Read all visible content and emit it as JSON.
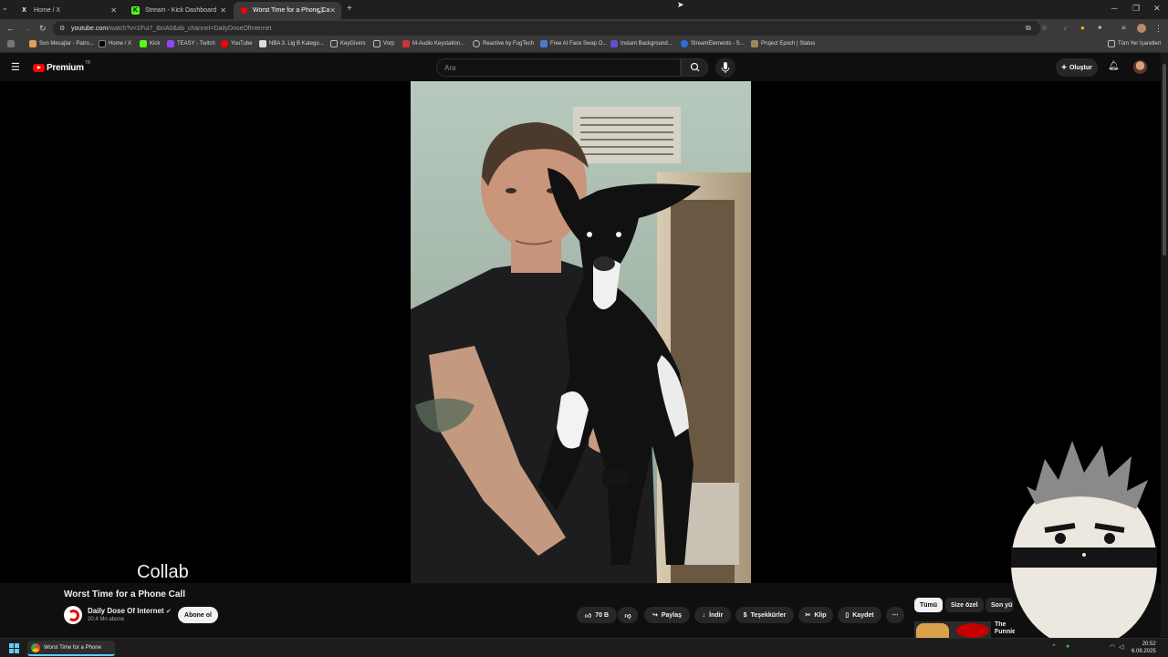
{
  "browser": {
    "tabs": [
      {
        "label": "Home / X",
        "favicon": "x-icon"
      },
      {
        "label": "Stream - Kick Dashboard",
        "favicon": "kick-icon"
      },
      {
        "label": "Worst Time for a Phone Ca",
        "favicon": "youtube-icon"
      }
    ],
    "url_host": "youtube.com",
    "url_path": "/watch?v=1Fui7_tbnA0&ab_channel=DailyDoseOfInternet",
    "bookmarks": [
      "Son Mesajlar - Patro...",
      "Home / X",
      "Kick",
      "TEASY - Twitch",
      "YouTube",
      "NBA 3. Lig B Katego...",
      "KeyGivers",
      "Vorp",
      "M-Audio Keystation...",
      "Reactive by FugTech",
      "Free AI Face Swap O...",
      "Instant Background...",
      "StreamElements - S...",
      "Project Epoch | Status"
    ],
    "all_bookmarks": "Tüm Yer İşaretleri"
  },
  "youtube": {
    "logo_word": "Premium",
    "logo_region": "TR",
    "search_placeholder": "Ara",
    "create_label": "Oluştur"
  },
  "overlay": {
    "collab_text": "Collab"
  },
  "video": {
    "title": "Worst Time for a Phone Call",
    "channel": "Daily Dose Of Internet",
    "subscribers": "20,4 Mn abone",
    "subscribe_label": "Abone ol",
    "likes": "70 B",
    "share_label": "Paylaş",
    "download_label": "İndir",
    "thanks_label": "Teşekkürler",
    "clip_label": "Klip",
    "save_label": "Kaydet"
  },
  "sidebar": {
    "chips": [
      "Tümü",
      "Size özel",
      "Son yüklenenler"
    ],
    "rec_title": "The Funniest ... Internet"
  },
  "taskbar": {
    "app_label": "Worst Time for a Phone",
    "time": "20:52",
    "date": "6.08.2025"
  }
}
